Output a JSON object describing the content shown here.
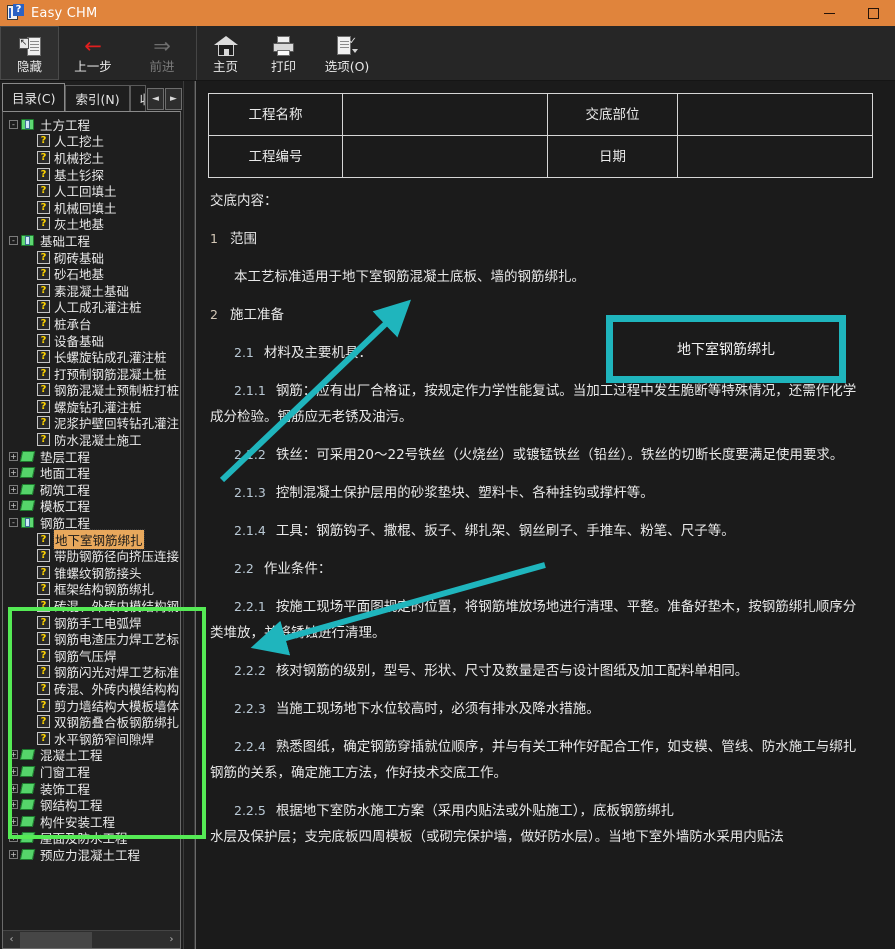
{
  "window": {
    "title": "Easy CHM",
    "icon": "chm-help-icon",
    "minimize_label": "—",
    "maximize_label": "□",
    "titlebar_color": "#e0843c"
  },
  "toolbar": {
    "buttons": [
      {
        "label": "隐藏",
        "icon": "hide-pane-icon",
        "state": "active"
      },
      {
        "label": "上一步",
        "icon": "back-arrow-icon",
        "state": "enabled"
      },
      {
        "label": "前进",
        "icon": "forward-arrow-icon",
        "state": "disabled"
      },
      {
        "label": "主页",
        "icon": "home-icon",
        "state": "enabled"
      },
      {
        "label": "打印",
        "icon": "printer-icon",
        "state": "enabled"
      },
      {
        "label": "选项(O)",
        "icon": "options-icon",
        "state": "enabled"
      }
    ]
  },
  "sidebar": {
    "tabs": [
      {
        "label": "目录(C)",
        "selected": true
      },
      {
        "label": "索引(N)",
        "selected": false
      },
      {
        "label": "收",
        "selected": false,
        "clipped": true
      }
    ],
    "tab_nav": {
      "prev": "◄",
      "next": "►"
    },
    "scrollbar": {
      "left_arrow": "‹",
      "right_arrow": "›"
    },
    "highlight_color": "#55ea55",
    "tree": [
      {
        "label": "土方工程",
        "type": "folder-open",
        "level": 1,
        "expander": "-"
      },
      {
        "label": "人工挖土",
        "type": "topic",
        "level": 2
      },
      {
        "label": "机械挖土",
        "type": "topic",
        "level": 2
      },
      {
        "label": "基土钐探",
        "type": "topic",
        "level": 2
      },
      {
        "label": "人工回填土",
        "type": "topic",
        "level": 2
      },
      {
        "label": "机械回填土",
        "type": "topic",
        "level": 2
      },
      {
        "label": "灰土地基",
        "type": "topic",
        "level": 2
      },
      {
        "label": "基础工程",
        "type": "folder-open",
        "level": 1,
        "expander": "-"
      },
      {
        "label": "砌砖基础",
        "type": "topic",
        "level": 2
      },
      {
        "label": "砂石地基",
        "type": "topic",
        "level": 2
      },
      {
        "label": "素混凝土基础",
        "type": "topic",
        "level": 2
      },
      {
        "label": "人工成孔灌注桩",
        "type": "topic",
        "level": 2
      },
      {
        "label": "桩承台",
        "type": "topic",
        "level": 2
      },
      {
        "label": "设备基础",
        "type": "topic",
        "level": 2
      },
      {
        "label": "长螺旋钻成孔灌注桩",
        "type": "topic",
        "level": 2
      },
      {
        "label": "打预制钢筋混凝土桩",
        "type": "topic",
        "level": 2
      },
      {
        "label": "钢筋混凝土预制桩打桩",
        "type": "topic",
        "level": 2
      },
      {
        "label": "螺旋钻孔灌注桩",
        "type": "topic",
        "level": 2
      },
      {
        "label": "泥浆护壁回转钻孔灌注",
        "type": "topic",
        "level": 2
      },
      {
        "label": "防水混凝土施工",
        "type": "topic",
        "level": 2
      },
      {
        "label": "垫层工程",
        "type": "folder",
        "level": 1,
        "expander": "+"
      },
      {
        "label": "地面工程",
        "type": "folder",
        "level": 1,
        "expander": "+"
      },
      {
        "label": "砌筑工程",
        "type": "folder",
        "level": 1,
        "expander": "+"
      },
      {
        "label": "模板工程",
        "type": "folder",
        "level": 1,
        "expander": "+"
      },
      {
        "label": "钢筋工程",
        "type": "folder-open",
        "level": 1,
        "expander": "-"
      },
      {
        "label": "地下室钢筋绑扎",
        "type": "topic",
        "level": 2,
        "selected": true
      },
      {
        "label": "带肋钢筋径向挤压连接",
        "type": "topic",
        "level": 2
      },
      {
        "label": "锥螺纹钢筋接头",
        "type": "topic",
        "level": 2
      },
      {
        "label": "框架结构钢筋绑扎",
        "type": "topic",
        "level": 2
      },
      {
        "label": "砖混、外砖内模结构钢",
        "type": "topic",
        "level": 2
      },
      {
        "label": "钢筋手工电弧焊",
        "type": "topic",
        "level": 2
      },
      {
        "label": "钢筋电渣压力焊工艺标",
        "type": "topic",
        "level": 2
      },
      {
        "label": "钢筋气压焊",
        "type": "topic",
        "level": 2
      },
      {
        "label": "钢筋闪光对焊工艺标准",
        "type": "topic",
        "level": 2
      },
      {
        "label": "砖混、外砖内模结构构",
        "type": "topic",
        "level": 2
      },
      {
        "label": "剪力墙结构大模板墙体",
        "type": "topic",
        "level": 2
      },
      {
        "label": "双钢筋叠合板钢筋绑扎",
        "type": "topic",
        "level": 2
      },
      {
        "label": "水平钢筋窄间隙焊",
        "type": "topic",
        "level": 2
      },
      {
        "label": "混凝土工程",
        "type": "folder",
        "level": 1,
        "expander": "+"
      },
      {
        "label": "门窗工程",
        "type": "folder",
        "level": 1,
        "expander": "+"
      },
      {
        "label": "装饰工程",
        "type": "folder",
        "level": 1,
        "expander": "+"
      },
      {
        "label": "钢结构工程",
        "type": "folder",
        "level": 1,
        "expander": "+"
      },
      {
        "label": "构件安装工程",
        "type": "folder",
        "level": 1,
        "expander": "+"
      },
      {
        "label": "屋面及防水工程",
        "type": "folder",
        "level": 1,
        "expander": "+"
      },
      {
        "label": "预应力混凝土工程",
        "type": "folder",
        "level": 1,
        "expander": "+"
      }
    ]
  },
  "document": {
    "header_table": [
      {
        "label": "工程名称",
        "value": "",
        "label2": "交底部位",
        "value2": ""
      },
      {
        "label": "工程编号",
        "value": "",
        "label2": "日期",
        "value2": ""
      }
    ],
    "content_label": "交底内容：",
    "doc_title": "地下室钢筋绑扎",
    "annotation_color": "#1fb5bd",
    "sections": [
      {
        "num": "1",
        "title": "范围"
      },
      {
        "num": "2",
        "title": "施工准备"
      }
    ],
    "paragraphs": [
      {
        "num": "",
        "text": "本工艺标准适用于地下室钢筋混凝土底板、墙的钢筋绑扎。"
      },
      {
        "num": "2.1",
        "text": "材料及主要机具："
      },
      {
        "num": "2.1.1",
        "text": "钢筋：应有出厂合格证，按规定作力学性能复试。当加工过程中发生脆断等特殊情况，还需作化学成分检验。钢筋应无老锈及油污。"
      },
      {
        "num": "2.1.2",
        "text": "铁丝：可采用20～22号铁丝（火烧丝）或镀锰铁丝（铅丝）。铁丝的切断长度要满足使用要求。"
      },
      {
        "num": "2.1.3",
        "text": "控制混凝土保护层用的砂浆垫块、塑料卡、各种挂钩或撑杆等。"
      },
      {
        "num": "2.1.4",
        "text": "工具：钢筋钩子、撒棍、扳子、绑扎架、钢丝刷子、手推车、粉笔、尺子等。"
      },
      {
        "num": "2.2",
        "text": "作业条件："
      },
      {
        "num": "2.2.1",
        "text": "按施工现场平面图规定的位置，将钢筋堆放场地进行清理、平整。准备好垫木，按钢筋绑扎顺序分类堆放，并将锈蚀进行清理。"
      },
      {
        "num": "2.2.2",
        "text": "核对钢筋的级别，型号、形状、尺寸及数量是否与设计图纸及加工配料单相同。"
      },
      {
        "num": "2.2.3",
        "text": "当施工现场地下水位较高时，必须有排水及降水措施。"
      },
      {
        "num": "2.2.4",
        "text": "熟悉图纸，确定钢筋穿插就位顺序，并与有关工种作好配合工作，如支模、管线、防水施工与绑扎钢筋的关系，确定施工方法，作好技术交底工作。"
      },
      {
        "num": "2.2.5",
        "text": "根据地下室防水施工方案（采用内贴法或外贴施工），底板钢筋绑扎"
      },
      {
        "num": "",
        "text": "水层及保护层；支完底板四周模板（或砌完保护墙，做好防水层）。当地下室外墙防水采用内贴法"
      }
    ]
  }
}
